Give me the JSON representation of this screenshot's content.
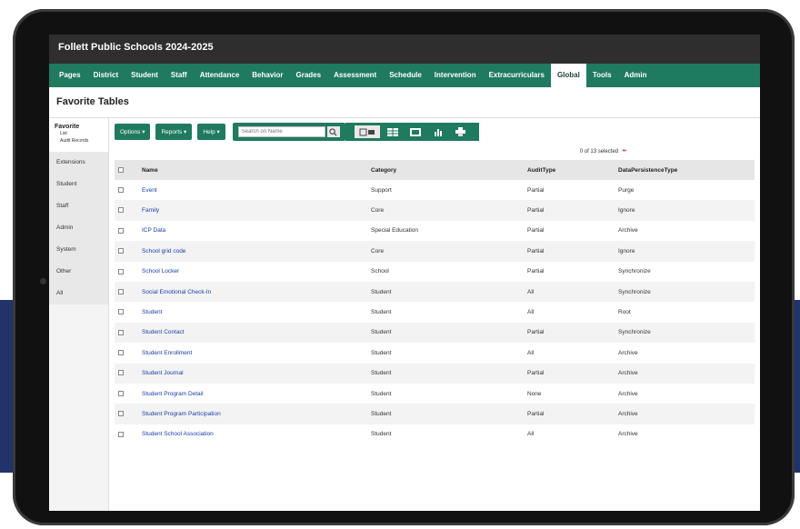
{
  "app": {
    "title": "Follett Public Schools 2024-2025"
  },
  "nav": {
    "tabs": [
      "Pages",
      "District",
      "Student",
      "Staff",
      "Attendance",
      "Behavior",
      "Grades",
      "Assessment",
      "Schedule",
      "Intervention",
      "Extracurriculars",
      "Global",
      "Tools",
      "Admin"
    ],
    "active": "Global"
  },
  "page": {
    "title": "Favorite Tables"
  },
  "sidebar": {
    "favorite_title": "Favorite",
    "favorite_sub": [
      "List",
      "Audit Records"
    ],
    "items": [
      "Extensions",
      "Student",
      "Staff",
      "Admin",
      "System",
      "Other",
      "All"
    ]
  },
  "toolbar": {
    "options_label": "Options ▾",
    "reports_label": "Reports ▾",
    "help_label": "Help ▾",
    "search_placeholder": "Search on Name"
  },
  "selection": {
    "text": "0 of 13 selected"
  },
  "table": {
    "columns": [
      "Name",
      "Category",
      "AuditType",
      "DataPersistenceType"
    ],
    "rows": [
      [
        "Event",
        "Support",
        "Partial",
        "Purge"
      ],
      [
        "Family",
        "Core",
        "Partial",
        "Ignore"
      ],
      [
        "ICP Data",
        "Special Education",
        "Partial",
        "Archive"
      ],
      [
        "School grid code",
        "Core",
        "Partial",
        "Ignore"
      ],
      [
        "School Locker",
        "School",
        "Partial",
        "Synchronize"
      ],
      [
        "Social Emotional Check-In",
        "Student",
        "All",
        "Synchronize"
      ],
      [
        "Student",
        "Student",
        "All",
        "Root"
      ],
      [
        "Student Contact",
        "Student",
        "Partial",
        "Synchronize"
      ],
      [
        "Student Enrollment",
        "Student",
        "All",
        "Archive"
      ],
      [
        "Student Journal",
        "Student",
        "Partial",
        "Archive"
      ],
      [
        "Student Program Detail",
        "Student",
        "None",
        "Archive"
      ],
      [
        "Student Program Participation",
        "Student",
        "Partial",
        "Archive"
      ],
      [
        "Student School Association",
        "Student",
        "All",
        "Archive"
      ]
    ]
  },
  "colors": {
    "accent": "#1f7a5f",
    "titlebar": "#2e2e2e",
    "link": "#1a3ea6",
    "background_band": "#22336b"
  }
}
